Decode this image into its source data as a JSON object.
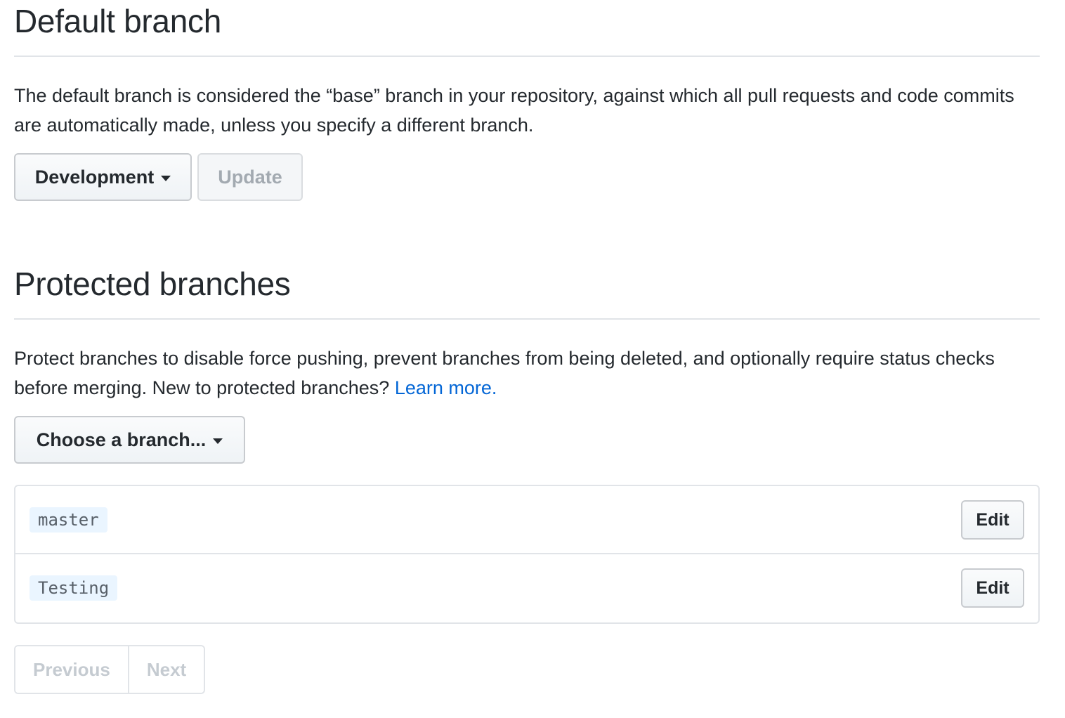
{
  "default_branch": {
    "title": "Default branch",
    "description": "The default branch is considered the “base” branch in your repository, against which all pull requests and code commits are automatically made, unless you specify a different branch.",
    "selected_branch": "Development",
    "update_label": "Update"
  },
  "protected_branches": {
    "title": "Protected branches",
    "description": "Protect branches to disable force pushing, prevent branches from being deleted, and optionally require status checks before merging. New to protected branches? ",
    "learn_more_label": "Learn more.",
    "choose_branch_label": "Choose a branch...",
    "branches": [
      {
        "name": "master",
        "edit_label": "Edit"
      },
      {
        "name": "Testing",
        "edit_label": "Edit"
      }
    ]
  },
  "pagination": {
    "previous_label": "Previous",
    "next_label": "Next"
  },
  "colors": {
    "text": "#24292e",
    "link": "#0366d6",
    "border": "#e1e4e8",
    "branch_tag_bg": "#eaf5ff",
    "disabled_text": "#a3aab1"
  },
  "icons": {
    "dropdown": "caret-down-icon"
  }
}
